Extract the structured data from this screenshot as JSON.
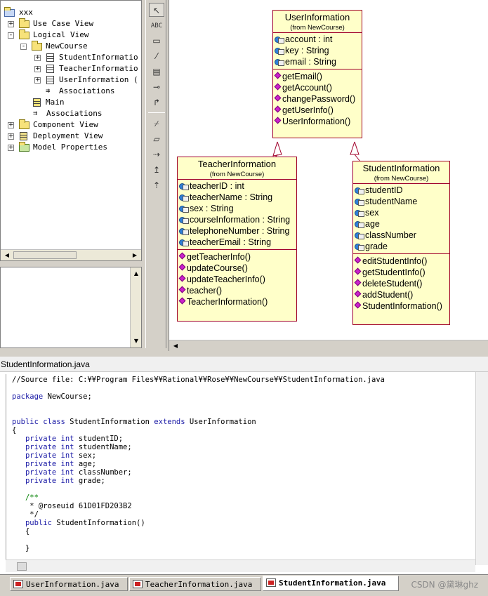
{
  "browser": {
    "root": "xxx",
    "items": [
      {
        "label": "Use Case View",
        "kind": "folder",
        "toggle": "+"
      },
      {
        "label": "Logical View",
        "kind": "folder",
        "toggle": "-"
      },
      {
        "label": "NewCourse",
        "kind": "folder",
        "toggle": "-"
      },
      {
        "label": "StudentInformatio",
        "kind": "class",
        "toggle": "+"
      },
      {
        "label": "TeacherInformatio",
        "kind": "class",
        "toggle": "+"
      },
      {
        "label": "UserInformation (",
        "kind": "class",
        "toggle": "+"
      },
      {
        "label": "Associations",
        "kind": "assoc",
        "toggle": ""
      },
      {
        "label": "Main",
        "kind": "diagram",
        "toggle": ""
      },
      {
        "label": "Associations",
        "kind": "assoc",
        "toggle": ""
      },
      {
        "label": "Component View",
        "kind": "folder",
        "toggle": "+"
      },
      {
        "label": "Deployment View",
        "kind": "deploy",
        "toggle": "+"
      },
      {
        "label": "Model Properties",
        "kind": "props",
        "toggle": "+"
      }
    ]
  },
  "toolbox": {
    "text_tool": "ABC"
  },
  "diagram": {
    "user": {
      "name": "UserInformation",
      "from": "(from NewCourse)",
      "attributes": [
        "account : int",
        "key : String",
        "email : String"
      ],
      "operations": [
        "getEmail()",
        "getAccount()",
        "changePassword()",
        "getUserInfo()",
        "UserInformation()"
      ]
    },
    "teacher": {
      "name": "TeacherInformation",
      "from": "(from NewCourse)",
      "attributes": [
        "teacherID : int",
        "teacherName : String",
        "sex : String",
        "courseInformation : String",
        "telephoneNumber : String",
        "teacherEmail : String"
      ],
      "operations": [
        "getTeacherInfo()",
        "updateCourse()",
        "updateTeacherInfo()",
        "teacher()",
        "TeacherInformation()"
      ]
    },
    "student": {
      "name": "StudentInformation",
      "from": "(from NewCourse)",
      "attributes": [
        "studentID",
        "studentName",
        "sex",
        "age",
        "classNumber",
        "grade"
      ],
      "operations": [
        "editStudentInfo()",
        "getStudentInfo()",
        "deleteStudent()",
        "addStudent()",
        "StudentInformation()"
      ]
    }
  },
  "editor": {
    "title": "StudentInformation.java",
    "code": {
      "source_comment": "//Source file: C:¥¥Program Files¥¥Rational¥¥Rose¥¥NewCourse¥¥StudentInformation.java",
      "package_kw": "package",
      "package_name": " NewCourse;",
      "decl_kw1": "public class",
      "decl_name": " StudentInformation ",
      "decl_kw2": "extends",
      "decl_super": " UserInformation",
      "open_brace": "{",
      "field_kw": "private int",
      "fields": [
        " studentID;",
        " studentName;",
        " sex;",
        " age;",
        " classNumber;",
        " grade;"
      ],
      "doc_open": "/**",
      "doc_line": " * @roseuid 61D01FD203B2",
      "doc_close": " */",
      "ctor_kw": "public",
      "ctor_name": " StudentInformation()",
      "ctor_open": "{",
      "ctor_close": "}"
    }
  },
  "tabs": [
    {
      "label": "UserInformation.java",
      "active": false
    },
    {
      "label": "TeacherInformation.java",
      "active": false
    },
    {
      "label": "StudentInformation.java",
      "active": true
    }
  ],
  "watermark": "CSDN @黛琳ghz"
}
